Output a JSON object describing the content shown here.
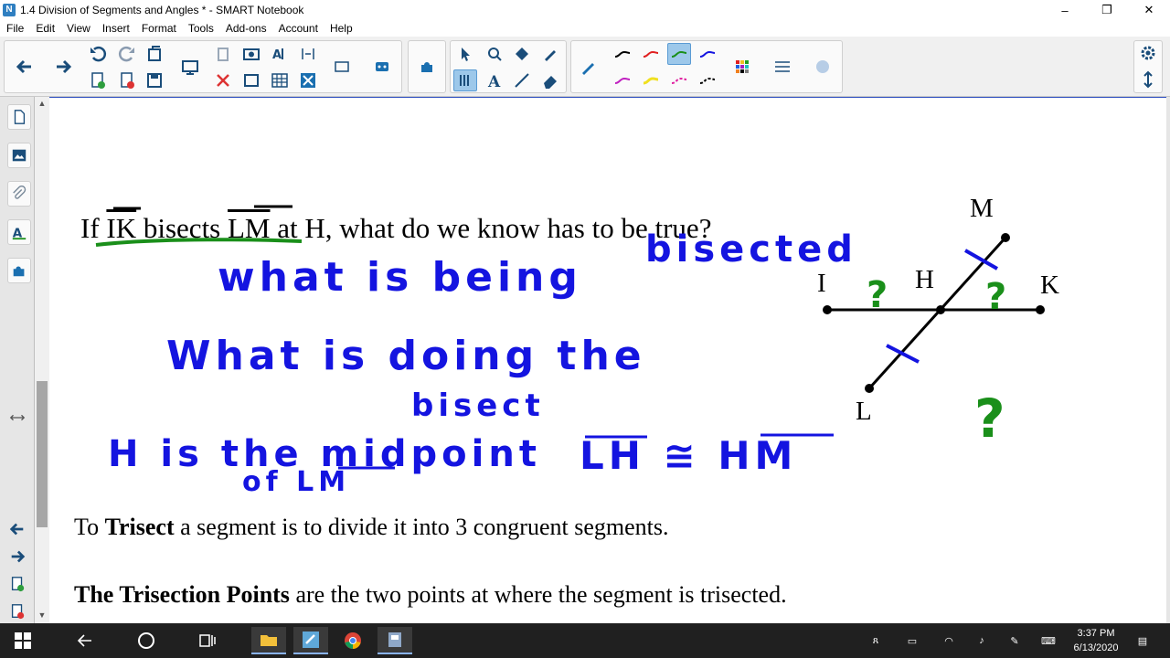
{
  "window": {
    "title": "1.4 Division of Segments and Angles * - SMART Notebook",
    "minimize": "–",
    "restore": "❐",
    "close": "✕"
  },
  "menu": [
    "File",
    "Edit",
    "View",
    "Insert",
    "Format",
    "Tools",
    "Add-ons",
    "Account",
    "Help"
  ],
  "colors": {
    "ink_blue": "#1414e0",
    "ink_green": "#1a8f1a",
    "taskbar": "#202020",
    "active_tool": "#9dc8ea"
  },
  "slide": {
    "question": {
      "p1": "If ",
      "seg1": "IK",
      "p2": " bisects ",
      "seg2": "LM",
      "p3": " at H, what do we know has to be true?"
    },
    "trisect": {
      "p1": "To ",
      "bold": "Trisect",
      "p2": " a segment is to divide it into 3 congruent segments."
    },
    "trisection_points": {
      "bold": "The Trisection Points",
      "p2": " are the two points at where the segment is trisected."
    },
    "diagram_labels": {
      "M": "M",
      "I": "I",
      "H": "H",
      "K": "K",
      "L": "L"
    }
  },
  "ink": {
    "line1": "what is being",
    "line1b": "bisected",
    "line2": "What is doing the",
    "line2b": "bisect",
    "line3a": "H is the midpoint",
    "line3b": "of LM",
    "line3c": "LH ≅ HM",
    "q": "?"
  },
  "taskbar": {
    "time": "3:37 PM",
    "date": "6/13/2020"
  },
  "icons": [
    "windows-start",
    "back-arrow",
    "cortana-circle",
    "task-view",
    "file-explorer",
    "smart-notebook",
    "chrome",
    "app-icon"
  ]
}
